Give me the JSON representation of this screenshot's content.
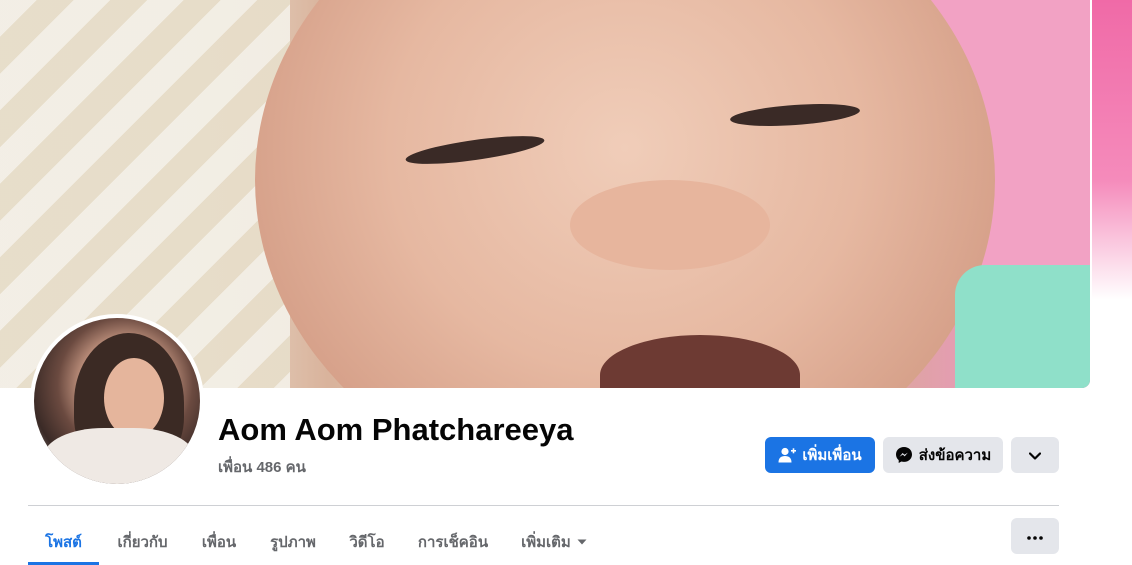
{
  "profile": {
    "name": "Aom Aom Phatchareeya",
    "friends_text": "เพื่อน 486 คน"
  },
  "actions": {
    "add_friend_label": "เพิ่มเพื่อน",
    "message_label": "ส่งข้อความ"
  },
  "tabs": [
    {
      "label": "โพสต์",
      "active": true
    },
    {
      "label": "เกี่ยวกับ"
    },
    {
      "label": "เพื่อน"
    },
    {
      "label": "รูปภาพ"
    },
    {
      "label": "วิดีโอ"
    },
    {
      "label": "การเช็คอิน"
    },
    {
      "label": "เพิ่มเติม"
    }
  ],
  "icons": {
    "add_friend": "add-friend-icon",
    "messenger": "messenger-icon",
    "chevron": "chevron-down-icon",
    "more": "more-dots-icon"
  },
  "colors": {
    "accent": "#1b74e4",
    "secondary_button": "#e4e6eb",
    "muted_text": "#65676b"
  }
}
